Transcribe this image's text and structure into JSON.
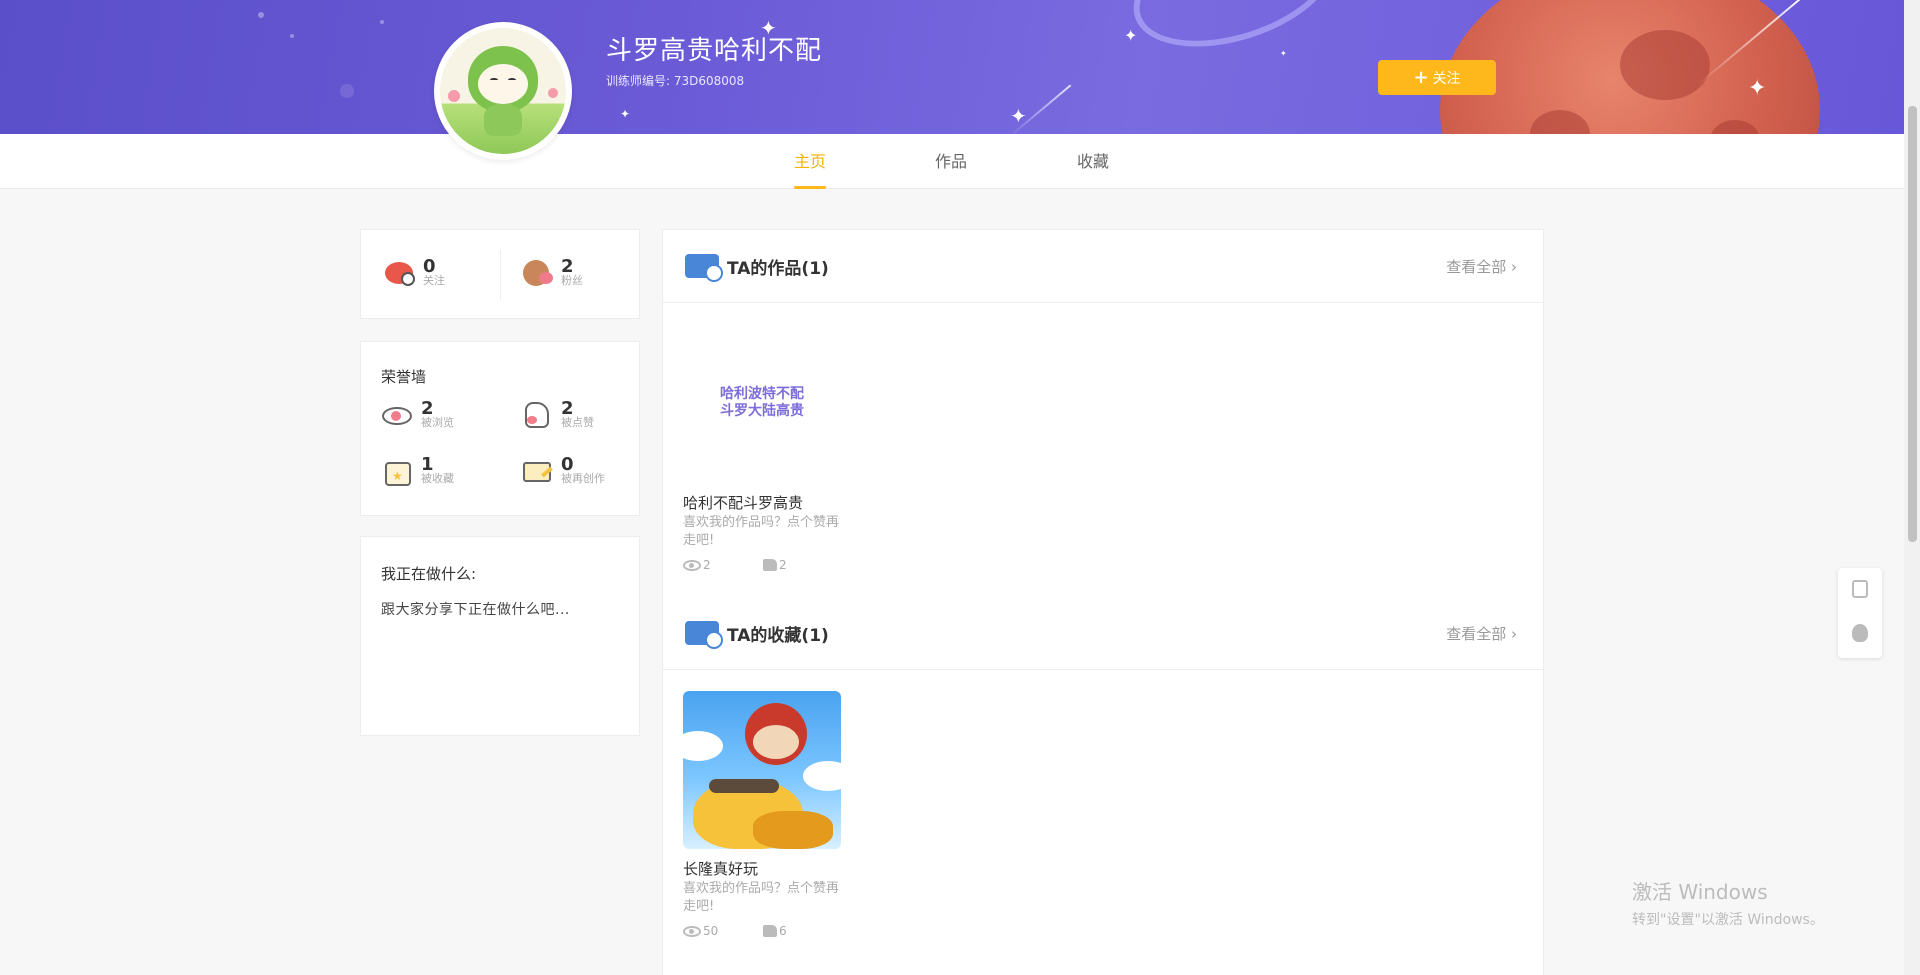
{
  "profile": {
    "username": "斗罗高贵哈利不配",
    "trainer_id": "训练师编号: 73D608008",
    "follow_label": "关注"
  },
  "tabs": [
    {
      "label": "主页",
      "active": true
    },
    {
      "label": "作品",
      "active": false
    },
    {
      "label": "收藏",
      "active": false
    }
  ],
  "stats": {
    "following": {
      "value": "0",
      "label": "关注"
    },
    "fans": {
      "value": "2",
      "label": "粉丝"
    }
  },
  "honor_wall": {
    "title": "荣誉墙",
    "items": [
      {
        "value": "2",
        "label": "被浏览",
        "icon": "eye-icon"
      },
      {
        "value": "2",
        "label": "被点赞",
        "icon": "like-icon"
      },
      {
        "value": "1",
        "label": "被收藏",
        "icon": "collect-box-icon"
      },
      {
        "value": "0",
        "label": "被再创作",
        "icon": "recreate-icon"
      }
    ]
  },
  "status": {
    "title": "我正在做什么:",
    "text": "跟大家分享下正在做什么吧..."
  },
  "works": {
    "title": "TA的作品(1)",
    "view_all": "查看全部",
    "items": [
      {
        "thumb_text_line1": "哈利波特不配",
        "thumb_text_line2": "斗罗大陆高贵",
        "name": "哈利不配斗罗高贵",
        "desc": "喜欢我的作品吗？点个赞再走吧!",
        "views": "2",
        "likes": "2"
      }
    ]
  },
  "favorites": {
    "title": "TA的收藏(1)",
    "view_all": "查看全部",
    "items": [
      {
        "name": "长隆真好玩",
        "desc": "喜欢我的作品吗？点个赞再走吧!",
        "views": "50",
        "likes": "6"
      }
    ]
  },
  "watermark": {
    "title": "激活 Windows",
    "subtitle": "转到\"设置\"以激活 Windows。"
  },
  "colors": {
    "accent": "#ffb81c",
    "banner": "#6a5ad6",
    "active_tab": "#f0b400"
  }
}
